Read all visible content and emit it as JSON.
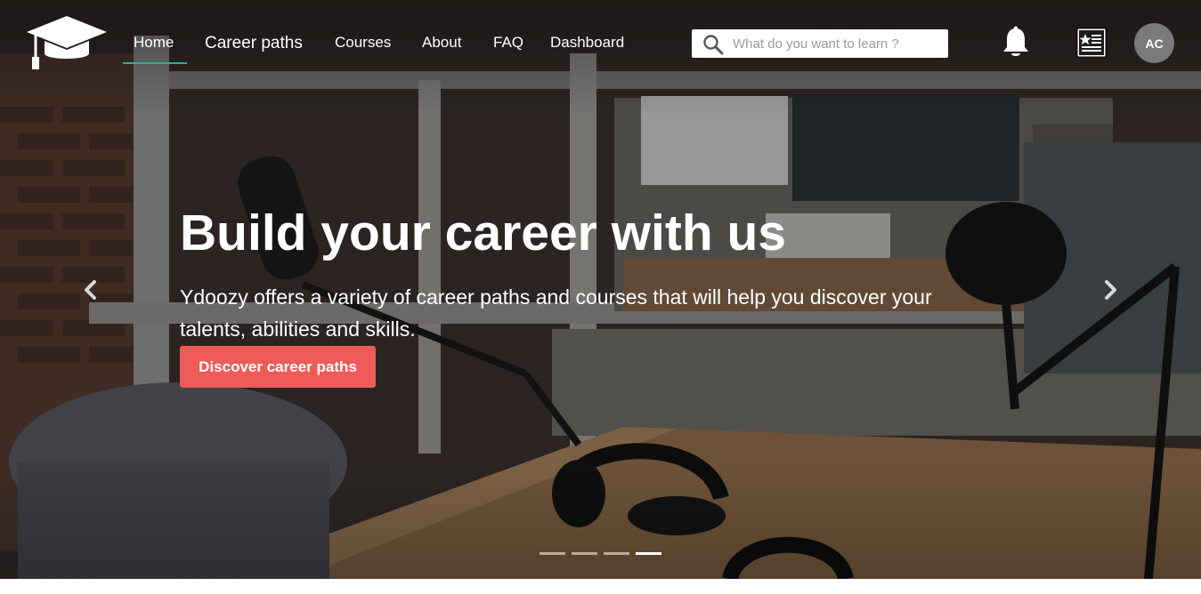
{
  "nav": {
    "items": [
      {
        "label": "Home"
      },
      {
        "label": "Career paths"
      },
      {
        "label": "Courses"
      },
      {
        "label": "About"
      },
      {
        "label": "FAQ"
      },
      {
        "label": "Dashboard"
      }
    ],
    "active_item": "Home",
    "search_placeholder": "What do you want to learn ?",
    "search_value": "",
    "avatar_initials": "AC",
    "icons": [
      "graduation-cap-logo",
      "search-icon",
      "bell-icon",
      "news-icon"
    ]
  },
  "hero": {
    "headline": "Build your career with us",
    "subtitle": "Ydoozy offers a variety of career paths and courses that will help you discover your talents, abilities and skills.",
    "cta_label": "Discover career paths",
    "slide_count": 4,
    "active_slide": 4,
    "arrows": [
      "chevron-left-icon",
      "chevron-right-icon"
    ]
  },
  "colors": {
    "accent_underline": "#27b39a",
    "cta_background": "#ef5b58",
    "avatar_background": "#7a7a7a"
  }
}
